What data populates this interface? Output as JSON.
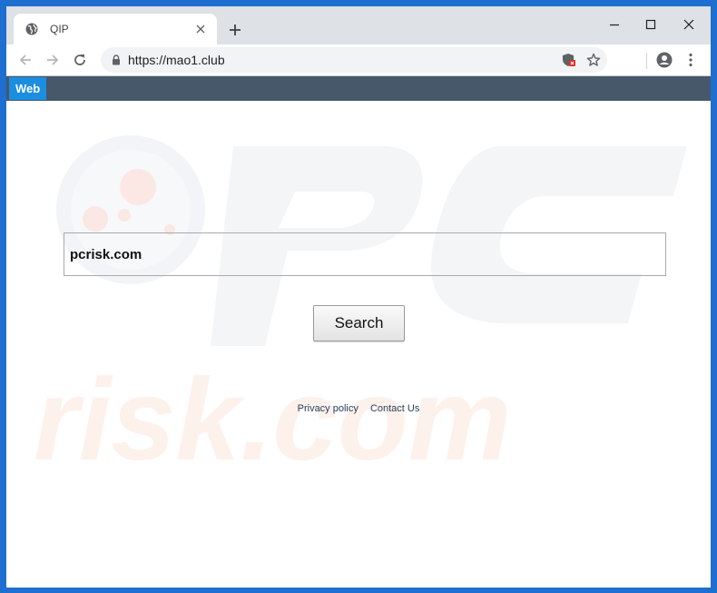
{
  "browser": {
    "tab": {
      "title": "QIP"
    },
    "address_bar": {
      "url": "https://mao1.club"
    }
  },
  "site_nav": {
    "web_label": "Web"
  },
  "search": {
    "value": "pcrisk.com",
    "button_label": "Search"
  },
  "footer": {
    "privacy_label": "Privacy policy",
    "contact_label": "Contact Us"
  },
  "watermark": {
    "text": "risk.com"
  },
  "colors": {
    "desktop": "#1e6fd0",
    "site_bar": "#46586a",
    "web_tab": "#1b8ee0",
    "link": "#2a3e5c"
  }
}
